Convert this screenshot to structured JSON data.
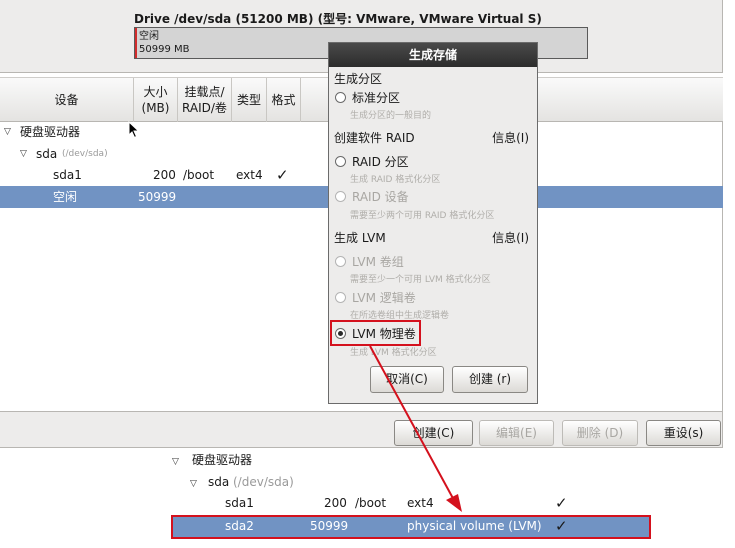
{
  "drive": {
    "title": "Drive /dev/sda (51200 MB) (型号: VMware, VMware Virtual S)",
    "free_label": "空闲",
    "free_size": "50999 MB"
  },
  "table": {
    "headers": {
      "device": "设备",
      "size_1": "大小",
      "size_2": "(MB)",
      "mount_1": "挂载点/",
      "mount_2": "RAID/卷",
      "type": "类型",
      "format": "格式"
    },
    "rows": {
      "hard_drives": "硬盘驱动器",
      "sda": "sda",
      "sda_path": "(/dev/sda)",
      "sda1": {
        "device": "sda1",
        "size": "200",
        "mount": "/boot",
        "type": "ext4",
        "format": "✓"
      },
      "free": {
        "device": "空闲",
        "size": "50999"
      }
    }
  },
  "buttons": {
    "create": "创建(C)",
    "edit": "编辑(E)",
    "delete": "删除 (D)",
    "reset": "重设(s)"
  },
  "dialog": {
    "title": "生成存储",
    "sec_partition": "生成分区",
    "opt_standard": "标准分区",
    "desc_standard": "生成分区的一般目的",
    "sec_raid": "创建软件 RAID",
    "info_raid": "信息(I)",
    "opt_raid_partition": "RAID 分区",
    "desc_raid_partition": "生成 RAID 格式化分区",
    "opt_raid_device": "RAID 设备",
    "desc_raid_device": "需要至少两个可用 RAID 格式化分区",
    "sec_lvm": "生成 LVM",
    "info_lvm": "信息(I)",
    "opt_lvm_vg": "LVM 卷组",
    "desc_lvm_vg": "需要至少一个可用 LVM 格式化分区",
    "opt_lvm_lv": "LVM 逻辑卷",
    "desc_lvm_lv": "在所选卷组中生成逻辑卷",
    "opt_lvm_pv": "LVM 物理卷",
    "desc_lvm_pv": "生成 LVM 格式化分区",
    "cancel": "取消(C)",
    "create": "创建 (r)"
  },
  "result": {
    "hard_drives": "硬盘驱动器",
    "sda": "sda",
    "sda_path": "(/dev/sda)",
    "sda1": {
      "device": "sda1",
      "size": "200",
      "mount": "/boot",
      "type": "ext4",
      "format": "✓"
    },
    "sda2": {
      "device": "sda2",
      "size": "50999",
      "type": "physical volume (LVM)",
      "format": "✓"
    }
  },
  "colors": {
    "selection": "#7193c3",
    "annotation_red": "#d4111d"
  }
}
